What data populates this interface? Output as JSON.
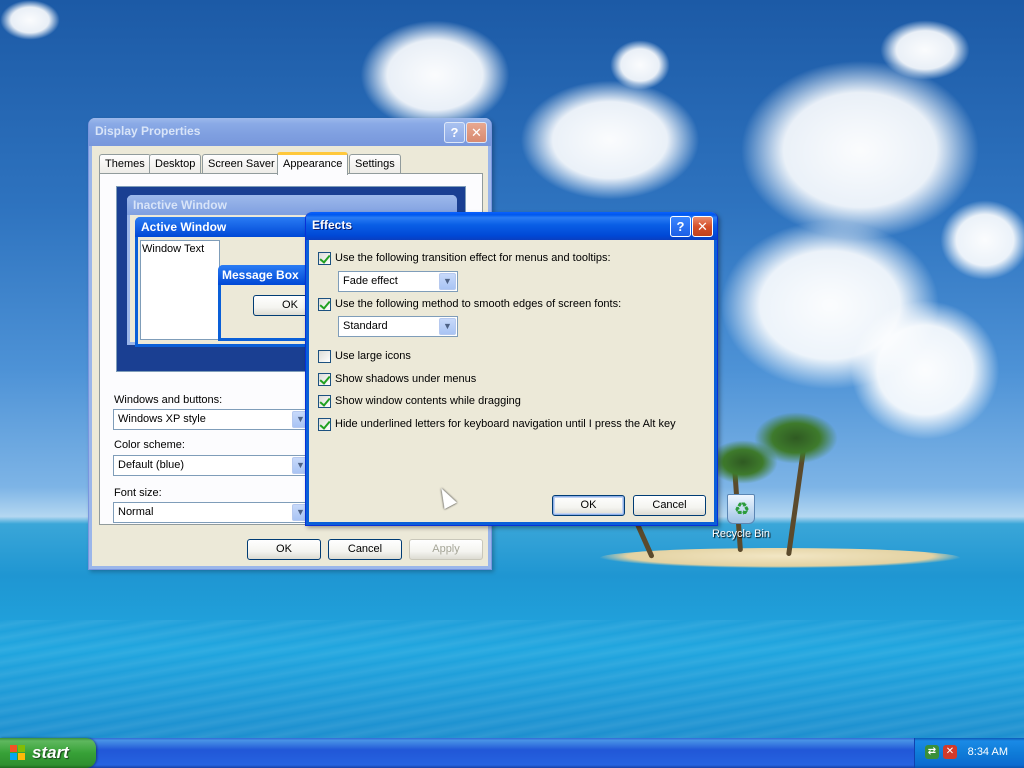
{
  "display_properties": {
    "title": "Display Properties",
    "help_icon": "question-icon",
    "close_icon": "close-icon",
    "tabs": [
      {
        "label": "Themes"
      },
      {
        "label": "Desktop"
      },
      {
        "label": "Screen Saver"
      },
      {
        "label": "Appearance",
        "active": true
      },
      {
        "label": "Settings"
      }
    ],
    "preview": {
      "inactive_title": "Inactive Window",
      "active_title": "Active Window",
      "window_text": "Window Text",
      "message_box_title": "Message Box",
      "ok_label": "OK"
    },
    "windows_buttons_label": "Windows and buttons:",
    "windows_buttons_value": "Windows XP style",
    "color_scheme_label": "Color scheme:",
    "color_scheme_value": "Default (blue)",
    "font_size_label": "Font size:",
    "font_size_value": "Normal",
    "ok_label": "OK",
    "cancel_label": "Cancel",
    "apply_label": "Apply"
  },
  "effects": {
    "title": "Effects",
    "options": [
      {
        "label": "Use the following transition effect for menus and tooltips:",
        "checked": true
      },
      {
        "label": "Use the following method to smooth edges of screen fonts:",
        "checked": true
      },
      {
        "label": "Use large icons",
        "checked": false
      },
      {
        "label": "Show shadows under menus",
        "checked": true
      },
      {
        "label": "Show window contents while dragging",
        "checked": true
      },
      {
        "label": "Hide underlined letters for keyboard navigation until I press the Alt key",
        "checked": true
      }
    ],
    "transition_value": "Fade effect",
    "smoothing_value": "Standard",
    "ok_label": "OK",
    "cancel_label": "Cancel"
  },
  "desktop": {
    "recycle_bin_label": "Recycle Bin"
  },
  "taskbar": {
    "start_label": "start",
    "clock": "8:34 AM",
    "tray_icons": [
      "network-icon",
      "security-shield-icon"
    ]
  },
  "colors": {
    "xp_blue": "#0a5fe6",
    "window_face": "#ece9d8",
    "start_green": "#37a137",
    "tab_highlight": "#ffc83c"
  }
}
